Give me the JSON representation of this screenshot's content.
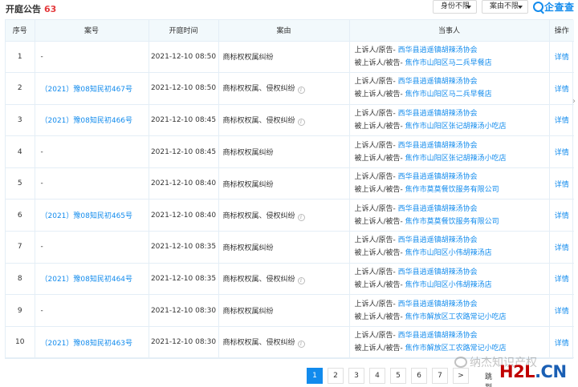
{
  "header": {
    "title": "开庭公告",
    "count": "63",
    "filters": [
      {
        "label": "身份不限"
      },
      {
        "label": "案由不限"
      }
    ],
    "logo_text": "企查查"
  },
  "table": {
    "columns": [
      "序号",
      "案号",
      "开庭时间",
      "案由",
      "当事人",
      "操作"
    ],
    "rows": [
      {
        "no": "1",
        "case": "-",
        "time": "2021-12-10 08:50",
        "reason": "商标权权属纠纷",
        "has_info": false,
        "role1": "上诉人/原告- ",
        "party1": "西华县逍遥镇胡辣汤协会",
        "role2": "被上诉人/被告- ",
        "party2": "焦作市山阳区马二兵早餐店",
        "op": "详情"
      },
      {
        "no": "2",
        "case": "（2021）豫08知民初467号",
        "time": "2021-12-10 08:50",
        "reason": "商标权权属、侵权纠纷",
        "has_info": true,
        "role1": "上诉人/原告- ",
        "party1": "西华县逍遥镇胡辣汤协会",
        "role2": "被上诉人/被告- ",
        "party2": "焦作市山阳区马二兵早餐店",
        "op": "详情"
      },
      {
        "no": "3",
        "case": "（2021）豫08知民初466号",
        "time": "2021-12-10 08:45",
        "reason": "商标权权属、侵权纠纷",
        "has_info": true,
        "role1": "上诉人/原告- ",
        "party1": "西华县逍遥镇胡辣汤协会",
        "role2": "被上诉人/被告- ",
        "party2": "焦作市山阳区张记胡辣汤小吃店",
        "op": "详情"
      },
      {
        "no": "4",
        "case": "-",
        "time": "2021-12-10 08:45",
        "reason": "商标权权属纠纷",
        "has_info": false,
        "role1": "上诉人/原告- ",
        "party1": "西华县逍遥镇胡辣汤协会",
        "role2": "被上诉人/被告- ",
        "party2": "焦作市山阳区张记胡辣汤小吃店",
        "op": "详情"
      },
      {
        "no": "5",
        "case": "-",
        "time": "2021-12-10 08:40",
        "reason": "商标权权属纠纷",
        "has_info": false,
        "role1": "上诉人/原告- ",
        "party1": "西华县逍遥镇胡辣汤协会",
        "role2": "被上诉人/被告- ",
        "party2": "焦作市莫莫餐饮服务有限公司",
        "op": "详情"
      },
      {
        "no": "6",
        "case": "（2021）豫08知民初465号",
        "time": "2021-12-10 08:40",
        "reason": "商标权权属、侵权纠纷",
        "has_info": true,
        "role1": "上诉人/原告- ",
        "party1": "西华县逍遥镇胡辣汤协会",
        "role2": "被上诉人/被告- ",
        "party2": "焦作市莫莫餐饮服务有限公司",
        "op": "详情"
      },
      {
        "no": "7",
        "case": "-",
        "time": "2021-12-10 08:35",
        "reason": "商标权权属纠纷",
        "has_info": false,
        "role1": "上诉人/原告- ",
        "party1": "西华县逍遥镇胡辣汤协会",
        "role2": "被上诉人/被告- ",
        "party2": "焦作市山阳区小伟胡辣汤店",
        "op": "详情"
      },
      {
        "no": "8",
        "case": "（2021）豫08知民初464号",
        "time": "2021-12-10 08:35",
        "reason": "商标权权属、侵权纠纷",
        "has_info": true,
        "role1": "上诉人/原告- ",
        "party1": "西华县逍遥镇胡辣汤协会",
        "role2": "被上诉人/被告- ",
        "party2": "焦作市山阳区小伟胡辣汤店",
        "op": "详情"
      },
      {
        "no": "9",
        "case": "-",
        "time": "2021-12-10 08:30",
        "reason": "商标权权属纠纷",
        "has_info": false,
        "role1": "上诉人/原告- ",
        "party1": "西华县逍遥镇胡辣汤协会",
        "role2": "被上诉人/被告- ",
        "party2": "焦作市解放区工农路常记小吃店",
        "op": "详情"
      },
      {
        "no": "10",
        "case": "（2021）豫08知民初463号",
        "time": "2021-12-10 08:30",
        "reason": "商标权权属、侵权纠纷",
        "has_info": true,
        "role1": "上诉人/原告- ",
        "party1": "西华县逍遥镇胡辣汤协会",
        "role2": "被上诉人/被告- ",
        "party2": "焦作市解放区工农路常记小吃店",
        "op": "详情"
      }
    ]
  },
  "pagination": {
    "pages": [
      "1",
      "2",
      "3",
      "4",
      "5",
      "6",
      "7"
    ],
    "next": ">",
    "jump_label": "跳到"
  },
  "watermark": {
    "text": "纳杰知识产权",
    "brand_a": "H2L",
    "brand_b": ".CN"
  },
  "colors": {
    "accent": "#128bed",
    "count": "#e4393c",
    "header_bg": "#f2f9fc"
  }
}
